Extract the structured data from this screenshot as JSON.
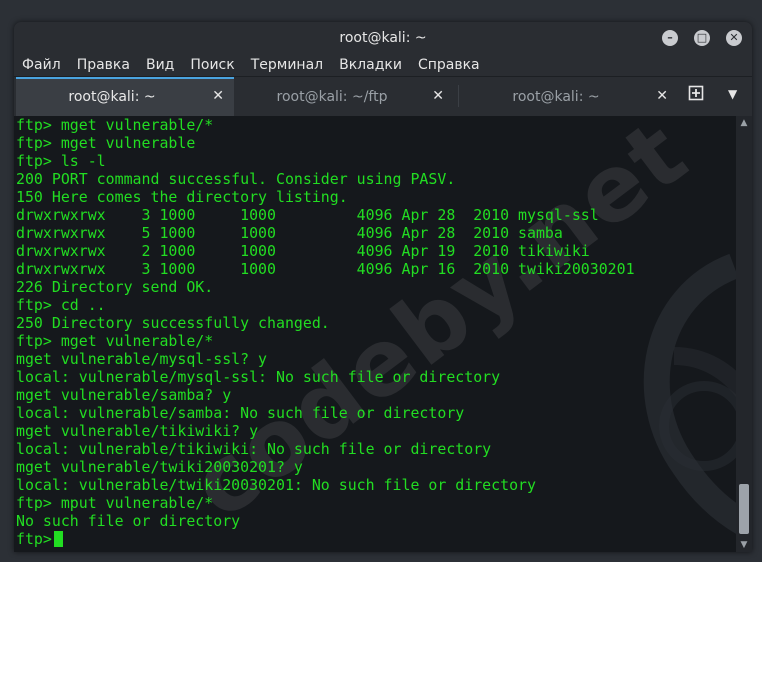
{
  "window": {
    "title": "root@kali: ~"
  },
  "menu": {
    "items": [
      "Файл",
      "Правка",
      "Вид",
      "Поиск",
      "Терминал",
      "Вкладки",
      "Справка"
    ]
  },
  "tabs": [
    {
      "label": "root@kali: ~",
      "active": true
    },
    {
      "label": "root@kali: ~/ftp",
      "active": false
    },
    {
      "label": "root@kali: ~",
      "active": false
    }
  ],
  "terminal": {
    "lines": [
      "ftp> mget vulnerable/*",
      "ftp> mget vulnerable",
      "ftp> ls -l",
      "200 PORT command successful. Consider using PASV.",
      "150 Here comes the directory listing.",
      "drwxrwxrwx    3 1000     1000         4096 Apr 28  2010 mysql-ssl",
      "drwxrwxrwx    5 1000     1000         4096 Apr 28  2010 samba",
      "drwxrwxrwx    2 1000     1000         4096 Apr 19  2010 tikiwiki",
      "drwxrwxrwx    3 1000     1000         4096 Apr 16  2010 twiki20030201",
      "226 Directory send OK.",
      "ftp> cd ..",
      "250 Directory successfully changed.",
      "ftp> mget vulnerable/*",
      "mget vulnerable/mysql-ssl? y",
      "local: vulnerable/mysql-ssl: No such file or directory",
      "mget vulnerable/samba? y",
      "local: vulnerable/samba: No such file or directory",
      "mget vulnerable/tikiwiki? y",
      "local: vulnerable/tikiwiki: No such file or directory",
      "mget vulnerable/twiki20030201? y",
      "local: vulnerable/twiki20030201: No such file or directory",
      "ftp> mput vulnerable/*",
      "No such file or directory"
    ],
    "prompt": "ftp>",
    "text_color": "#22dd22",
    "background": "#15181c"
  },
  "watermark": {
    "text": "codeby.net"
  },
  "icons": {
    "minimize": "minimize-icon",
    "maximize": "maximize-icon",
    "close": "close-icon",
    "new_tab": "new-tab-icon",
    "tab_menu": "chevron-down-icon"
  }
}
